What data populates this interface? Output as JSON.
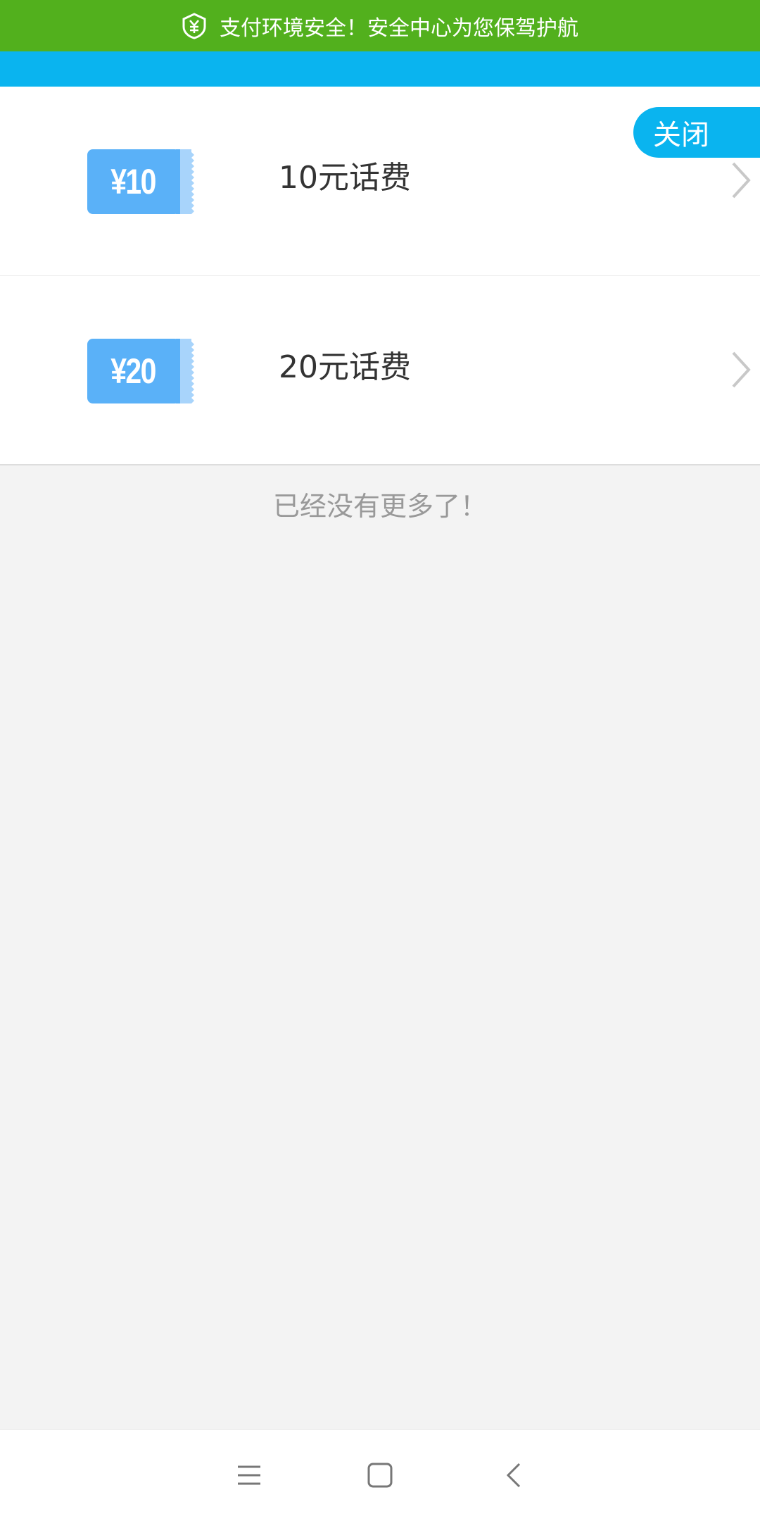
{
  "security_bar": {
    "text": "支付环境安全！安全中心为您保驾护航",
    "icon": "shield-yen-icon",
    "color": "#52b01d"
  },
  "header": {
    "accent_color": "#0ab4ef",
    "close_label": "关闭"
  },
  "items": [
    {
      "coupon_text": "¥10",
      "title": "10元话费"
    },
    {
      "coupon_text": "¥20",
      "title": "20元话费"
    }
  ],
  "footer_text": "已经没有更多了！",
  "nav": {
    "icons": [
      "menu-icon",
      "home-icon",
      "back-icon"
    ]
  }
}
